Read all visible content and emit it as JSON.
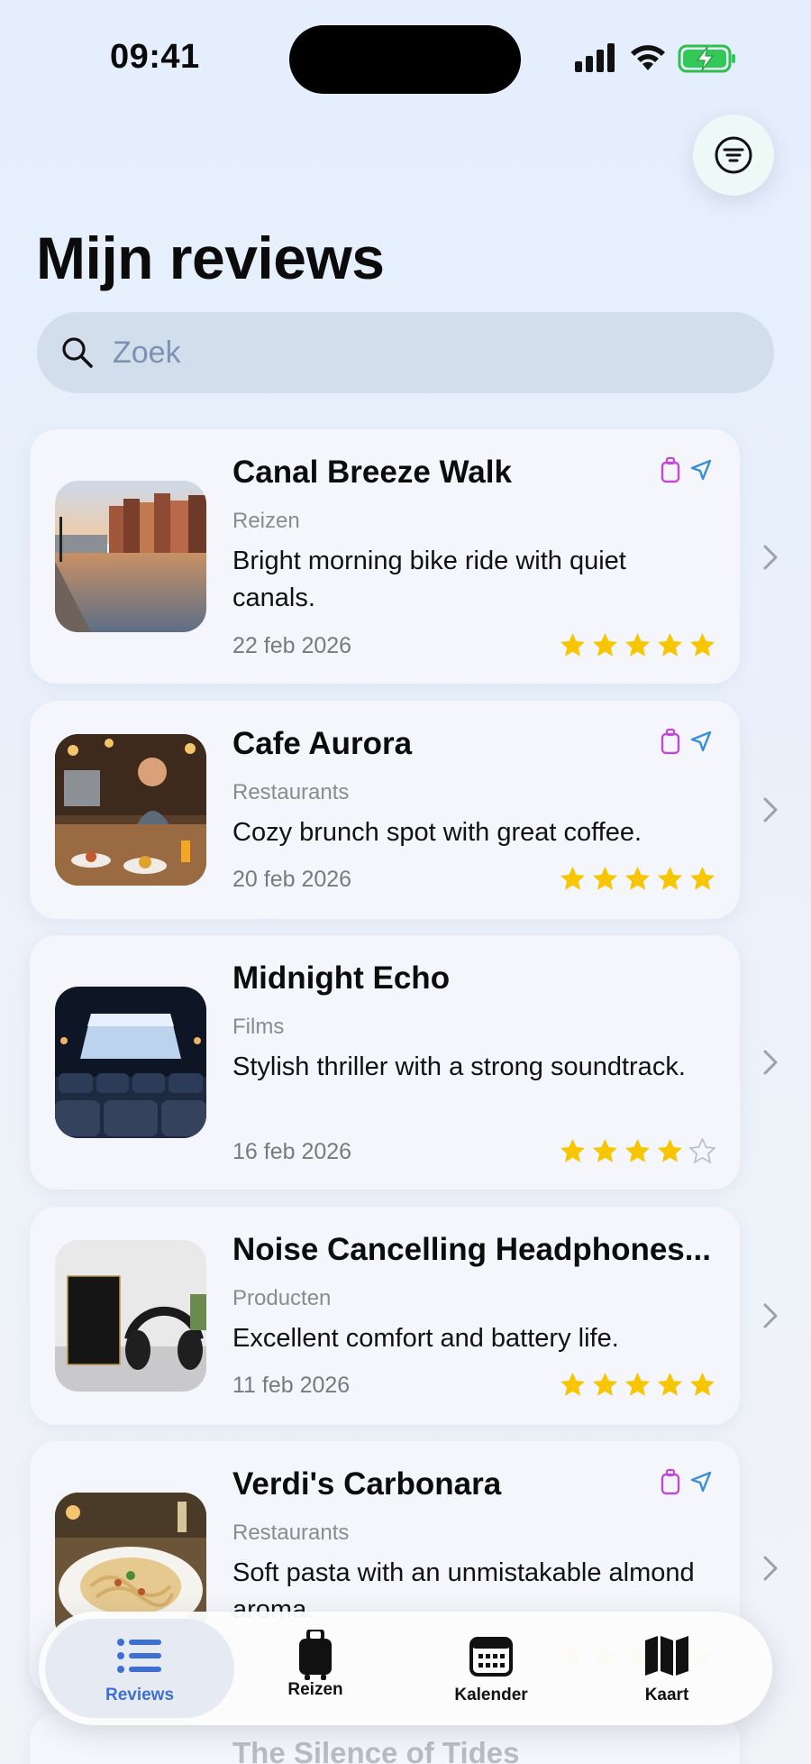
{
  "status_bar": {
    "time": "09:41"
  },
  "page": {
    "title": "Mijn reviews"
  },
  "search": {
    "placeholder": "Zoek"
  },
  "reviews": [
    {
      "title": "Canal Breeze Walk",
      "category": "Reizen",
      "text": "Bright morning bike ride with quiet canals.",
      "date": "22 feb 2026",
      "rating": 5,
      "badges": [
        "luggage-icon",
        "location-arrow-icon"
      ]
    },
    {
      "title": "Cafe Aurora",
      "category": "Restaurants",
      "text": "Cozy brunch spot with great coffee.",
      "date": "20 feb 2026",
      "rating": 5,
      "badges": [
        "luggage-icon",
        "location-arrow-icon"
      ]
    },
    {
      "title": "Midnight Echo",
      "category": "Films",
      "text": "Stylish thriller with a strong soundtrack.",
      "date": "16 feb 2026",
      "rating": 4,
      "badges": []
    },
    {
      "title": "Noise Cancelling Headphones...",
      "category": "Producten",
      "text": "Excellent comfort and battery life.",
      "date": "11 feb 2026",
      "rating": 5,
      "badges": []
    },
    {
      "title": "Verdi's Carbonara",
      "category": "Restaurants",
      "text": "Soft pasta with an unmistakable almond aroma.",
      "date": "",
      "rating": 5,
      "badges": [
        "luggage-icon",
        "location-arrow-icon"
      ]
    },
    {
      "title": "The Silence of Tides"
    }
  ],
  "tab_bar": {
    "tabs": [
      {
        "label": "Reviews",
        "icon": "list-icon",
        "active": true
      },
      {
        "label": "Reizen",
        "icon": "luggage-icon",
        "active": false
      },
      {
        "label": "Kalender",
        "icon": "calendar-icon",
        "active": false
      },
      {
        "label": "Kaart",
        "icon": "map-icon",
        "active": false
      }
    ]
  },
  "colors": {
    "accent": "#3f6fd1",
    "star": "#f7c600",
    "badge_luggage": "#c04ad6",
    "badge_location": "#3a8fd8"
  }
}
